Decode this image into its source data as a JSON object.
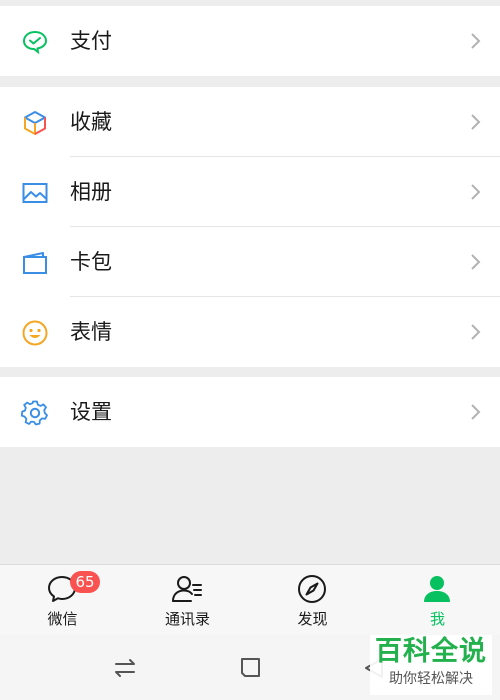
{
  "menu": {
    "pay": {
      "label": "支付",
      "icon": "wechat-pay-icon"
    },
    "favorites": {
      "label": "收藏",
      "icon": "cube-icon"
    },
    "album": {
      "label": "相册",
      "icon": "picture-icon"
    },
    "cards": {
      "label": "卡包",
      "icon": "card-wallet-icon"
    },
    "stickers": {
      "label": "表情",
      "icon": "smiley-icon"
    },
    "settings": {
      "label": "设置",
      "icon": "gear-icon"
    }
  },
  "tabbar": {
    "chats": {
      "label": "微信",
      "badge": "65",
      "icon": "chat-bubble-icon"
    },
    "contacts": {
      "label": "通讯录",
      "icon": "contacts-icon"
    },
    "discover": {
      "label": "发现",
      "icon": "compass-icon"
    },
    "me": {
      "label": "我",
      "icon": "person-icon",
      "active": true
    }
  },
  "watermark": {
    "title": "百科全说",
    "subtitle": "助你轻松解决"
  },
  "colors": {
    "accent_green": "#07c160",
    "badge_red": "#fa5151",
    "background": "#ededed",
    "blue_icon": "#3a8ee6",
    "smiley_orange": "#f5a623"
  }
}
